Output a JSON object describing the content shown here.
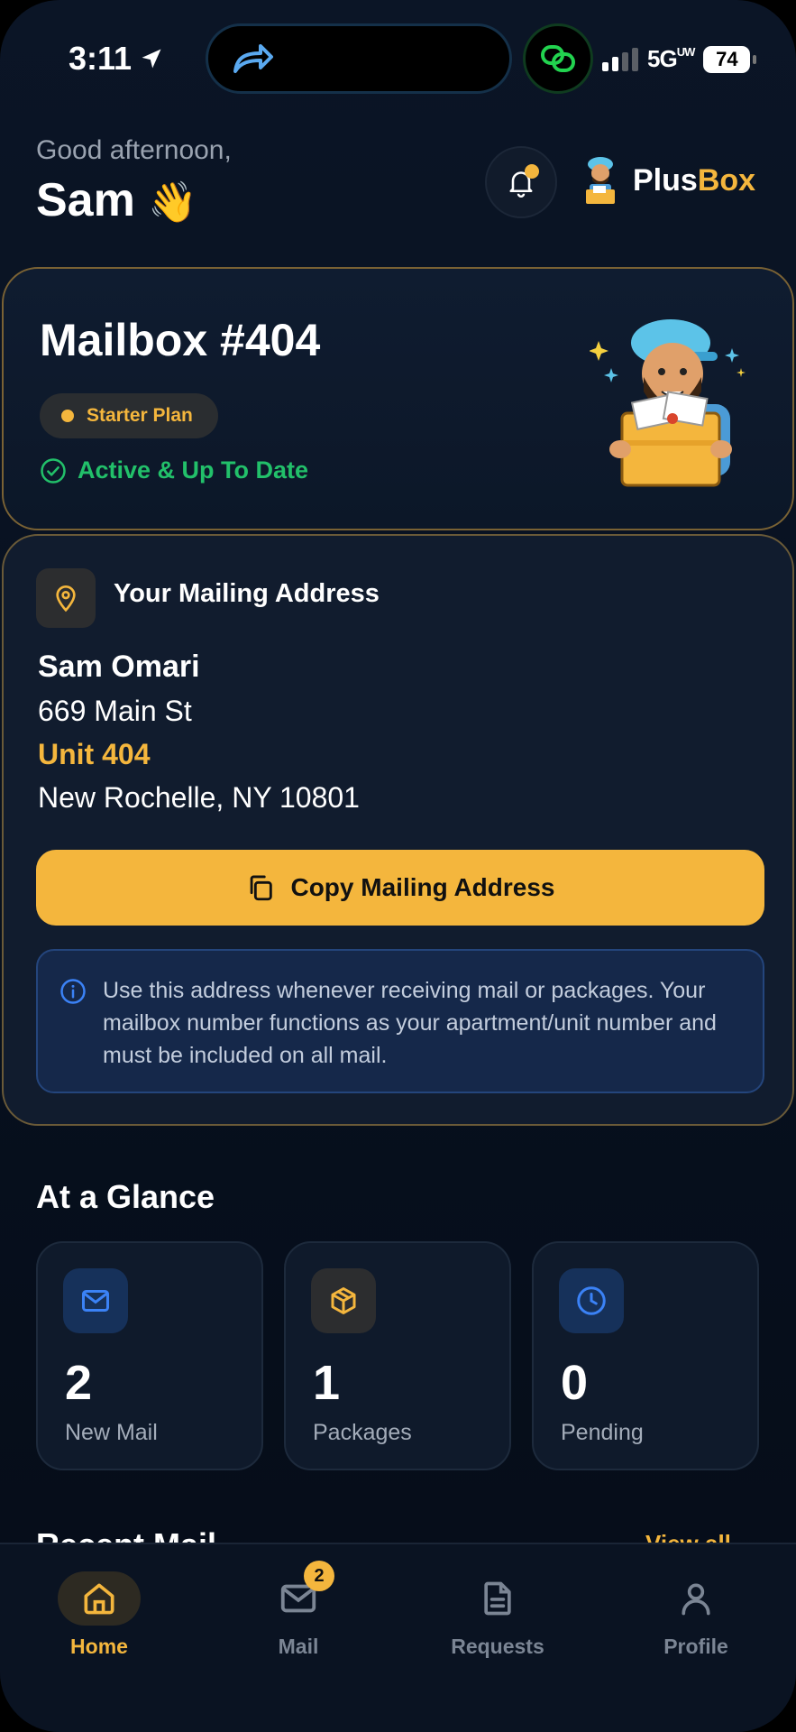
{
  "status_bar": {
    "time": "3:11",
    "network": "5G",
    "network_suffix": "UW",
    "battery": "74"
  },
  "header": {
    "greeting": "Good afternoon,",
    "name": "Sam",
    "wave_emoji": "👋",
    "brand_plus": "Plus",
    "brand_box": "Box"
  },
  "mailbox": {
    "title": "Mailbox #404",
    "plan": "Starter Plan",
    "status": "Active & Up To Date"
  },
  "address": {
    "heading": "Your Mailing Address",
    "name": "Sam Omari",
    "street": "669 Main St",
    "unit": "Unit 404",
    "city": "New Rochelle, NY 10801",
    "copy_button": "Copy Mailing Address",
    "info": "Use this address whenever receiving mail or packages. Your mailbox number functions as your apartment/unit number and must be included on all mail."
  },
  "glance": {
    "title": "At a Glance",
    "stats": [
      {
        "value": "2",
        "label": "New Mail",
        "icon": "mail-icon",
        "color": "#3b82f6"
      },
      {
        "value": "1",
        "label": "Packages",
        "icon": "package-icon",
        "color": "#f4b63d"
      },
      {
        "value": "0",
        "label": "Pending",
        "icon": "clock-icon",
        "color": "#3b82f6"
      }
    ]
  },
  "recent": {
    "title": "Recent Mail",
    "view_all": "View all"
  },
  "nav": {
    "items": [
      {
        "label": "Home",
        "icon": "home-icon",
        "active": true
      },
      {
        "label": "Mail",
        "icon": "mail-icon",
        "badge": "2"
      },
      {
        "label": "Requests",
        "icon": "document-icon"
      },
      {
        "label": "Profile",
        "icon": "user-icon"
      }
    ]
  },
  "colors": {
    "accent": "#f4b63d",
    "success": "#22c06a",
    "info": "#3b82f6",
    "background": "#0b1526"
  }
}
